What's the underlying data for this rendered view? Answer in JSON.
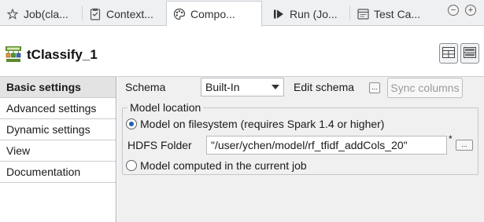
{
  "tabs": [
    {
      "label": "Job(cla...",
      "icon": "job-icon",
      "active": false
    },
    {
      "label": "Context...",
      "icon": "context-icon",
      "active": false
    },
    {
      "label": "Compo...",
      "icon": "palette-icon",
      "active": true
    },
    {
      "label": "Run (Jo...",
      "icon": "run-icon",
      "active": false
    },
    {
      "label": "Test Ca...",
      "icon": "test-case-icon",
      "active": false
    }
  ],
  "window_controls": {
    "minimize": "−",
    "maximize": "+"
  },
  "component": {
    "title": "tClassify_1",
    "icon": "classify-component-icon"
  },
  "sidebar": {
    "items": [
      {
        "label": "Basic settings",
        "active": true
      },
      {
        "label": "Advanced settings",
        "active": false
      },
      {
        "label": "Dynamic settings",
        "active": false
      },
      {
        "label": "View",
        "active": false
      },
      {
        "label": "Documentation",
        "active": false
      }
    ]
  },
  "basic": {
    "schema_label": "Schema",
    "schema_value": "Built-In",
    "edit_schema_label": "Edit schema",
    "edit_schema_btn": "...",
    "sync_columns_label": "Sync columns",
    "model_location_label": "Model location",
    "radio_filesystem_label": "Model on filesystem (requires Spark 1.4 or higher)",
    "hdfs_folder_label": "HDFS Folder",
    "hdfs_folder_value": "\"/user/ychen/model/rf_tfidf_addCols_20\"",
    "hdfs_required_mark": "*",
    "hdfs_browse_btn": "...",
    "radio_current_job_label": "Model computed in the current job"
  },
  "colors": {
    "accent": "#1f5fa8",
    "panel_bg": "#f0f0f0",
    "tab_bg": "#eef0f2"
  }
}
